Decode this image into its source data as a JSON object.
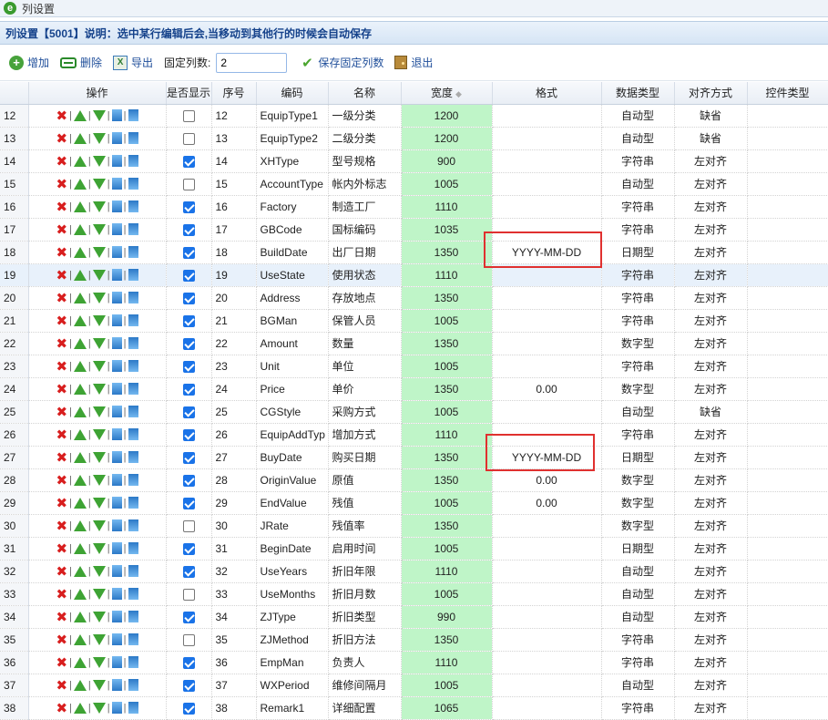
{
  "window": {
    "title": "列设置",
    "icon_name": "ie-icon"
  },
  "panel": {
    "title": "列设置【5001】说明：选中某行编辑后会,当移动到其他行的时候会自动保存"
  },
  "toolbar": {
    "add_label": "增加",
    "delete_label": "删除",
    "export_label": "导出",
    "fixed_cols_label": "固定列数:",
    "fixed_cols_value": "2",
    "save_fixed_label": "保存固定列数",
    "exit_label": "退出"
  },
  "columns": [
    "",
    "操作",
    "是否显示",
    "序号",
    "编码",
    "名称",
    "宽度",
    "格式",
    "数据类型",
    "对齐方式",
    "控件类型"
  ],
  "rows": [
    {
      "n": "12",
      "show": false,
      "seq": "12",
      "code": "EquipType1",
      "name": "一级分类",
      "width": "1200",
      "fmt": "",
      "dtype": "自动型",
      "align": "缺省"
    },
    {
      "n": "13",
      "show": false,
      "seq": "13",
      "code": "EquipType2",
      "name": "二级分类",
      "width": "1200",
      "fmt": "",
      "dtype": "自动型",
      "align": "缺省"
    },
    {
      "n": "14",
      "show": true,
      "seq": "14",
      "code": "XHType",
      "name": "型号规格",
      "width": "900",
      "fmt": "",
      "dtype": "字符串",
      "align": "左对齐"
    },
    {
      "n": "15",
      "show": false,
      "seq": "15",
      "code": "AccountType",
      "name": "帐内外标志",
      "width": "1005",
      "fmt": "",
      "dtype": "自动型",
      "align": "左对齐"
    },
    {
      "n": "16",
      "show": true,
      "seq": "16",
      "code": "Factory",
      "name": "制造工厂",
      "width": "1110",
      "fmt": "",
      "dtype": "字符串",
      "align": "左对齐"
    },
    {
      "n": "17",
      "show": true,
      "seq": "17",
      "code": "GBCode",
      "name": "国标编码",
      "width": "1035",
      "fmt": "",
      "dtype": "字符串",
      "align": "左对齐"
    },
    {
      "n": "18",
      "show": true,
      "seq": "18",
      "code": "BuildDate",
      "name": "出厂日期",
      "width": "1350",
      "fmt": "YYYY-MM-DD",
      "dtype": "日期型",
      "align": "左对齐"
    },
    {
      "n": "19",
      "show": true,
      "seq": "19",
      "code": "UseState",
      "name": "使用状态",
      "width": "1110",
      "fmt": "",
      "dtype": "字符串",
      "align": "左对齐"
    },
    {
      "n": "20",
      "show": true,
      "seq": "20",
      "code": "Address",
      "name": "存放地点",
      "width": "1350",
      "fmt": "",
      "dtype": "字符串",
      "align": "左对齐"
    },
    {
      "n": "21",
      "show": true,
      "seq": "21",
      "code": "BGMan",
      "name": "保管人员",
      "width": "1005",
      "fmt": "",
      "dtype": "字符串",
      "align": "左对齐"
    },
    {
      "n": "22",
      "show": true,
      "seq": "22",
      "code": "Amount",
      "name": "数量",
      "width": "1350",
      "fmt": "",
      "dtype": "数字型",
      "align": "左对齐"
    },
    {
      "n": "23",
      "show": true,
      "seq": "23",
      "code": "Unit",
      "name": "单位",
      "width": "1005",
      "fmt": "",
      "dtype": "字符串",
      "align": "左对齐"
    },
    {
      "n": "24",
      "show": true,
      "seq": "24",
      "code": "Price",
      "name": "单价",
      "width": "1350",
      "fmt": "0.00",
      "dtype": "数字型",
      "align": "左对齐"
    },
    {
      "n": "25",
      "show": true,
      "seq": "25",
      "code": "CGStyle",
      "name": "采购方式",
      "width": "1005",
      "fmt": "",
      "dtype": "自动型",
      "align": "缺省"
    },
    {
      "n": "26",
      "show": true,
      "seq": "26",
      "code": "EquipAddTyp",
      "name": "增加方式",
      "width": "1110",
      "fmt": "",
      "dtype": "字符串",
      "align": "左对齐"
    },
    {
      "n": "27",
      "show": true,
      "seq": "27",
      "code": "BuyDate",
      "name": "购买日期",
      "width": "1350",
      "fmt": "YYYY-MM-DD",
      "dtype": "日期型",
      "align": "左对齐"
    },
    {
      "n": "28",
      "show": true,
      "seq": "28",
      "code": "OriginValue",
      "name": "原值",
      "width": "1350",
      "fmt": "0.00",
      "dtype": "数字型",
      "align": "左对齐"
    },
    {
      "n": "29",
      "show": true,
      "seq": "29",
      "code": "EndValue",
      "name": "残值",
      "width": "1005",
      "fmt": "0.00",
      "dtype": "数字型",
      "align": "左对齐"
    },
    {
      "n": "30",
      "show": false,
      "seq": "30",
      "code": "JRate",
      "name": "残值率",
      "width": "1350",
      "fmt": "",
      "dtype": "数字型",
      "align": "左对齐"
    },
    {
      "n": "31",
      "show": true,
      "seq": "31",
      "code": "BeginDate",
      "name": "启用时间",
      "width": "1005",
      "fmt": "",
      "dtype": "日期型",
      "align": "左对齐"
    },
    {
      "n": "32",
      "show": true,
      "seq": "32",
      "code": "UseYears",
      "name": "折旧年限",
      "width": "1110",
      "fmt": "",
      "dtype": "自动型",
      "align": "左对齐"
    },
    {
      "n": "33",
      "show": false,
      "seq": "33",
      "code": "UseMonths",
      "name": "折旧月数",
      "width": "1005",
      "fmt": "",
      "dtype": "自动型",
      "align": "左对齐"
    },
    {
      "n": "34",
      "show": true,
      "seq": "34",
      "code": "ZJType",
      "name": "折旧类型",
      "width": "990",
      "fmt": "",
      "dtype": "自动型",
      "align": "左对齐"
    },
    {
      "n": "35",
      "show": false,
      "seq": "35",
      "code": "ZJMethod",
      "name": "折旧方法",
      "width": "1350",
      "fmt": "",
      "dtype": "字符串",
      "align": "左对齐"
    },
    {
      "n": "36",
      "show": true,
      "seq": "36",
      "code": "EmpMan",
      "name": "负责人",
      "width": "1110",
      "fmt": "",
      "dtype": "字符串",
      "align": "左对齐"
    },
    {
      "n": "37",
      "show": true,
      "seq": "37",
      "code": "WXPeriod",
      "name": "维修间隔月",
      "width": "1005",
      "fmt": "",
      "dtype": "自动型",
      "align": "左对齐"
    },
    {
      "n": "38",
      "show": true,
      "seq": "38",
      "code": "Remark1",
      "name": "详细配置",
      "width": "1065",
      "fmt": "",
      "dtype": "字符串",
      "align": "左对齐"
    }
  ],
  "colors": {
    "width_cell_bg": "#bff5c8",
    "highlight_box": "#e0302f",
    "header_text": "#15428b",
    "selected_row": "#e8f1fb"
  }
}
